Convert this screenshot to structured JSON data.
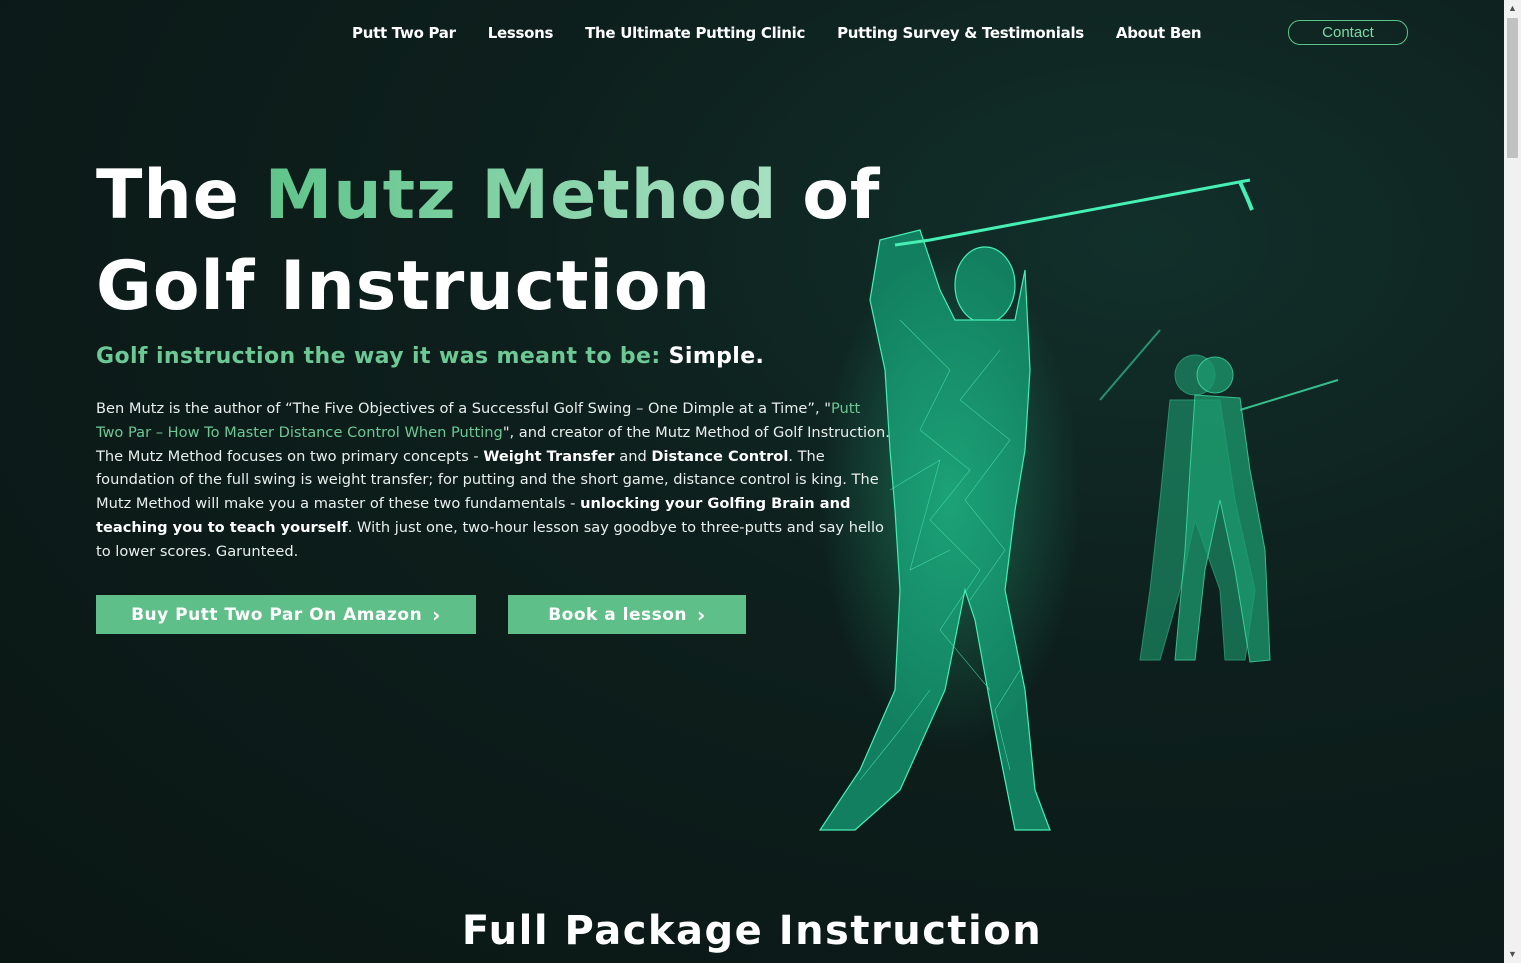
{
  "nav": {
    "links": [
      "Putt Two Par",
      "Lessons",
      "The Ultimate Putting Clinic",
      "Putting Survey & Testimonials",
      "About Ben"
    ],
    "contact_label": "Contact"
  },
  "hero": {
    "title_part1": "The ",
    "title_accent": "Mutz Method",
    "title_part2": " of",
    "title_line2": "Golf Instruction",
    "tagline_green": "Golf instruction the way it was meant to be: ",
    "tagline_white": "Simple.",
    "body": {
      "t1": "Ben Mutz is the author of “The Five Objectives of a Successful Golf Swing – One Dimple at a Time”, \"",
      "link": "Putt Two Par – How To Master Distance Control When Putting",
      "t2": "\", and creator of the Mutz Method of Golf Instruction. The Mutz Method focuses on two primary concepts - ",
      "b1": "Weight Transfer",
      "t3": " and ",
      "b2": "Distance Control",
      "t4": ". The foundation of the full swing is weight transfer; for putting and the short game, distance control is king. The Mutz Method will make you a master of these two fundamentals - ",
      "b3": "unlocking your Golfing Brain and teaching you to teach yourself",
      "t5": ". With just one, two-hour lesson say goodbye to three-putts and say hello to lower scores. Garunteed."
    },
    "buttons": {
      "amazon": "Buy Putt Two Par On Amazon",
      "lesson": "Book a lesson"
    }
  },
  "section": {
    "title": "Full Package Instruction"
  },
  "colors": {
    "accent": "#5fbf88",
    "background": "#0d1f1c",
    "golfer": "#2fe0a0"
  },
  "icons": {
    "button_arrow": "chevron-right-icon",
    "scroll_up": "arrow-up-icon",
    "scroll_down": "arrow-down-icon"
  }
}
